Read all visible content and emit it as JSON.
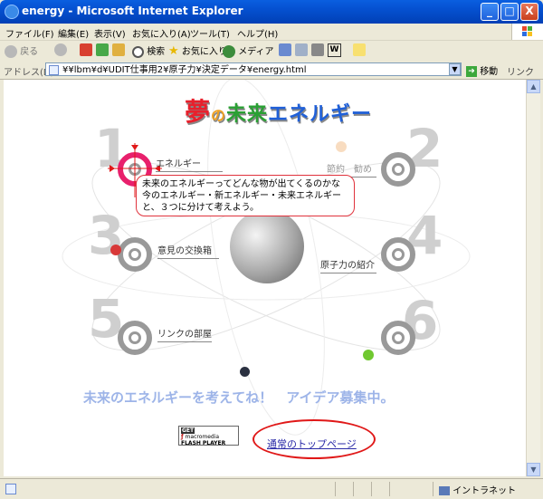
{
  "window": {
    "title": "energy - Microsoft Internet Explorer",
    "minimize": "_",
    "maximize": "□",
    "close": "X"
  },
  "menu": {
    "items": [
      "ファイル(F)",
      "編集(E)",
      "表示(V)",
      "お気に入り(A)",
      "ツール(T)",
      "ヘルプ(H)"
    ]
  },
  "toolbar": {
    "back": "戻る",
    "search": "検索",
    "favorites": "お気に入り",
    "media": "メディア"
  },
  "address": {
    "label": "アドレス(D)",
    "url": "¥¥lbm¥d¥UDIT仕事用2¥原子力¥決定データ¥energy.html",
    "go": "移動",
    "links": "リンク"
  },
  "page": {
    "title_parts": [
      "夢",
      "の",
      "未来",
      "エネルギー"
    ],
    "numbers": [
      "1",
      "2",
      "3",
      "4",
      "5",
      "6"
    ],
    "items": {
      "item1": "エネルギー",
      "item2": "節約",
      "item2b": "勧め",
      "item3": "意見の交換箱",
      "item4": "原子力の紹介",
      "item5": "リンクの部屋"
    },
    "bubble": "未来のエネルギーってどんな物が出てくるのかな今のエネルギー・新エネルギー・未来エネルギーと、３つに分けて考えよう。",
    "slogan": "未来のエネルギーを考えてね！　アイデア募集中。",
    "flash_badge": [
      "GET",
      "macromedia",
      "FLASH",
      "PLAYER"
    ],
    "top_link": "通常のトップページ"
  },
  "status": {
    "zone": "イントラネット"
  },
  "colors": {
    "title_red": "#e8202c",
    "title_green": "#2aa034",
    "title_blue": "#2060d8",
    "slogan": "#9db4e8",
    "oval": "#e01818"
  }
}
